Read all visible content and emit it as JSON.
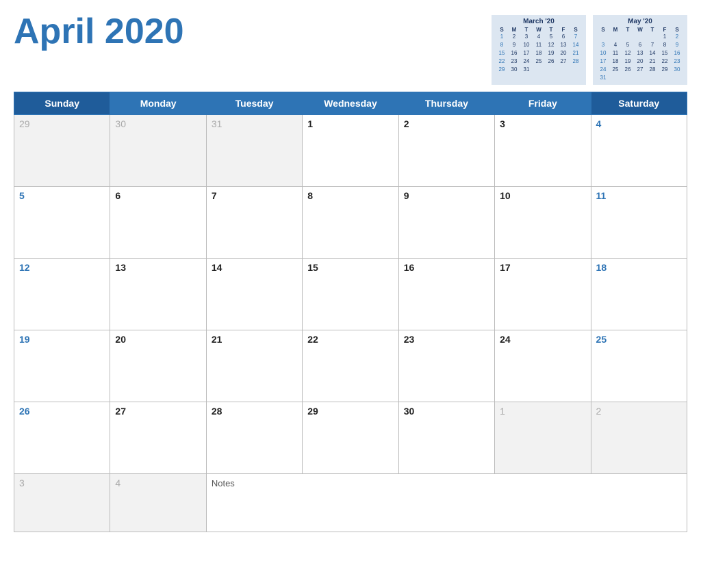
{
  "header": {
    "title": "April 2020"
  },
  "mini_cals": [
    {
      "title": "March '20",
      "days_header": [
        "S",
        "M",
        "T",
        "W",
        "T",
        "F",
        "S"
      ],
      "weeks": [
        [
          "",
          "",
          "",
          "",
          "",
          "",
          ""
        ],
        [
          "1",
          "2",
          "3",
          "4",
          "5",
          "6",
          "7"
        ],
        [
          "8",
          "9",
          "10",
          "11",
          "12",
          "13",
          "14"
        ],
        [
          "15",
          "16",
          "17",
          "18",
          "19",
          "20",
          "21"
        ],
        [
          "22",
          "23",
          "24",
          "25",
          "26",
          "27",
          "28"
        ],
        [
          "29",
          "30",
          "31",
          "",
          "",
          "",
          ""
        ]
      ]
    },
    {
      "title": "May '20",
      "days_header": [
        "S",
        "M",
        "T",
        "W",
        "T",
        "F",
        "S"
      ],
      "weeks": [
        [
          "",
          "",
          "",
          "",
          "",
          "1",
          "2"
        ],
        [
          "3",
          "4",
          "5",
          "6",
          "7",
          "8",
          "9"
        ],
        [
          "10",
          "11",
          "12",
          "13",
          "14",
          "15",
          "16"
        ],
        [
          "17",
          "18",
          "19",
          "20",
          "21",
          "22",
          "23"
        ],
        [
          "24",
          "25",
          "26",
          "27",
          "28",
          "29",
          "30"
        ],
        [
          "31",
          "",
          "",
          "",
          "",
          "",
          ""
        ]
      ]
    }
  ],
  "days_of_week": [
    "Sunday",
    "Monday",
    "Tuesday",
    "Wednesday",
    "Thursday",
    "Friday",
    "Saturday"
  ],
  "weeks": [
    [
      {
        "num": "29",
        "type": "out"
      },
      {
        "num": "30",
        "type": "out"
      },
      {
        "num": "31",
        "type": "out"
      },
      {
        "num": "1",
        "type": "in"
      },
      {
        "num": "2",
        "type": "in"
      },
      {
        "num": "3",
        "type": "in"
      },
      {
        "num": "4",
        "type": "in",
        "is_sat": true
      }
    ],
    [
      {
        "num": "5",
        "type": "in",
        "is_sun": true
      },
      {
        "num": "6",
        "type": "in"
      },
      {
        "num": "7",
        "type": "in"
      },
      {
        "num": "8",
        "type": "in"
      },
      {
        "num": "9",
        "type": "in"
      },
      {
        "num": "10",
        "type": "in"
      },
      {
        "num": "11",
        "type": "in",
        "is_sat": true
      }
    ],
    [
      {
        "num": "12",
        "type": "in",
        "is_sun": true
      },
      {
        "num": "13",
        "type": "in"
      },
      {
        "num": "14",
        "type": "in"
      },
      {
        "num": "15",
        "type": "in"
      },
      {
        "num": "16",
        "type": "in"
      },
      {
        "num": "17",
        "type": "in"
      },
      {
        "num": "18",
        "type": "in",
        "is_sat": true
      }
    ],
    [
      {
        "num": "19",
        "type": "in",
        "is_sun": true
      },
      {
        "num": "20",
        "type": "in"
      },
      {
        "num": "21",
        "type": "in"
      },
      {
        "num": "22",
        "type": "in"
      },
      {
        "num": "23",
        "type": "in"
      },
      {
        "num": "24",
        "type": "in"
      },
      {
        "num": "25",
        "type": "in",
        "is_sat": true
      }
    ],
    [
      {
        "num": "26",
        "type": "in",
        "is_sun": true
      },
      {
        "num": "27",
        "type": "in"
      },
      {
        "num": "28",
        "type": "in"
      },
      {
        "num": "29",
        "type": "in"
      },
      {
        "num": "30",
        "type": "in"
      },
      {
        "num": "1",
        "type": "out"
      },
      {
        "num": "2",
        "type": "out",
        "is_sat": true
      }
    ],
    [
      {
        "num": "3",
        "type": "out",
        "is_sun": true
      },
      {
        "num": "4",
        "type": "out"
      },
      {
        "num": "notes",
        "type": "notes",
        "colspan": 5
      }
    ]
  ],
  "notes_label": "Notes"
}
